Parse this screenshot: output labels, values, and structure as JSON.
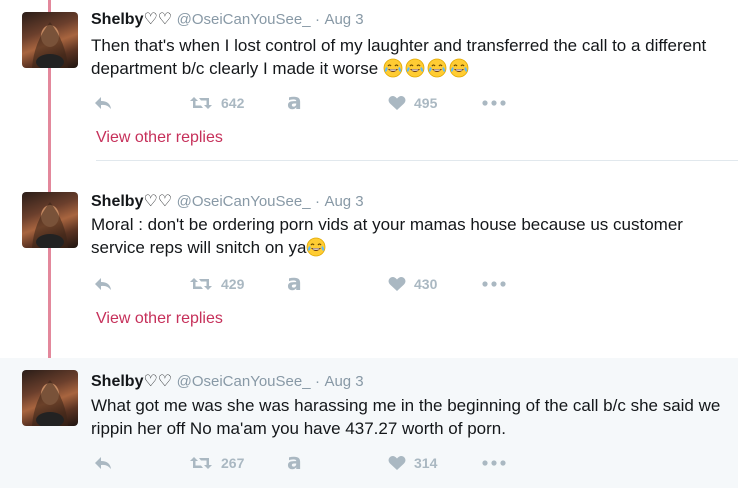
{
  "tweets": [
    {
      "name": "Shelby♡♡",
      "handle": "@OseiCanYouSee_",
      "dot": "·",
      "date": "Aug 3",
      "text": "Then that's when I lost control of my laughter and transferred the call to a different department b/c clearly I made it worse",
      "emoji_count": 4,
      "retweets": "642",
      "likes": "495",
      "view_replies": "View other replies"
    },
    {
      "name": "Shelby♡♡",
      "handle": "@OseiCanYouSee_",
      "dot": "·",
      "date": "Aug 3",
      "text": "Moral : don't be ordering porn vids at your mamas house because us customer service reps will snitch on ya",
      "emoji_count": 1,
      "retweets": "429",
      "likes": "430",
      "view_replies": "View other replies"
    },
    {
      "name": "Shelby♡♡",
      "handle": "@OseiCanYouSee_",
      "dot": "·",
      "date": "Aug 3",
      "text": "What got me was she was harassing me in the beginning of the call b/c she said we rippin her off No ma'am you have 437.27 worth of porn.",
      "emoji_count": 0,
      "retweets": "267",
      "likes": "314"
    }
  ],
  "icons": {
    "reply": "reply-icon",
    "retweet": "retweet-icon",
    "amazon": "amazon-icon",
    "like": "heart-icon",
    "more": "more-icon",
    "emoji": "tears-of-joy-emoji"
  },
  "colors": {
    "thread_line": "#e3889c",
    "link": "#c6305a",
    "muted": "#8899a6",
    "action": "#aab8c2",
    "highlight_bg": "#f5f8fa"
  }
}
